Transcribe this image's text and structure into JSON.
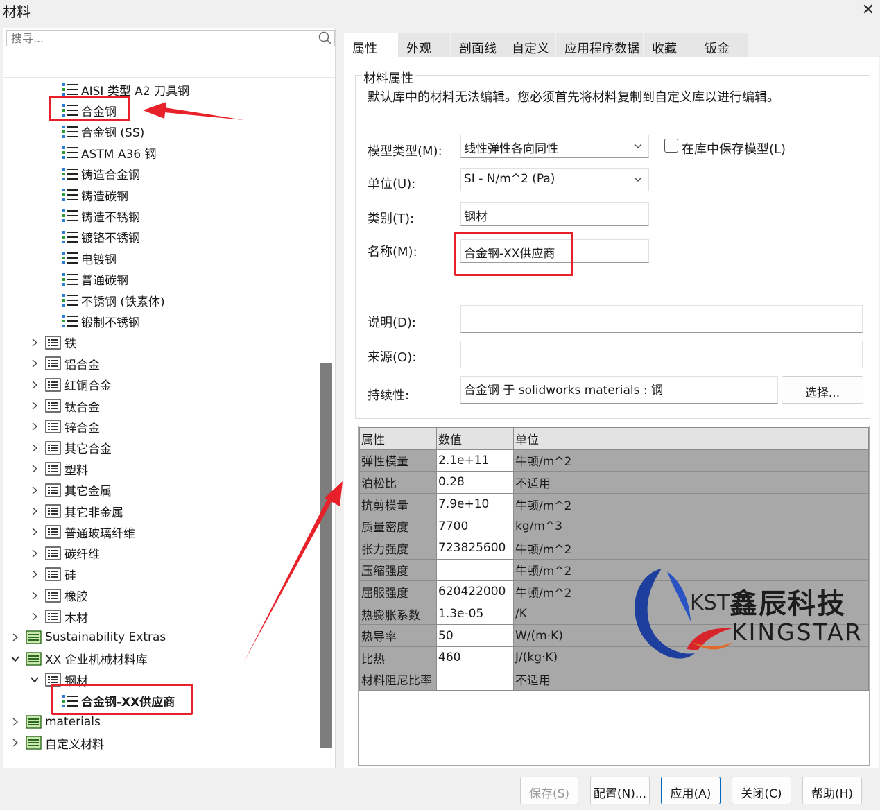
{
  "window": {
    "title": "材料"
  },
  "search": {
    "placeholder": "搜寻..."
  },
  "tree": [
    {
      "label": "AISI 类型 A2 刀具钢",
      "indent": 3,
      "icon": "material-icon",
      "chev": ""
    },
    {
      "label": "合金钢",
      "indent": 3,
      "icon": "material-icon",
      "chev": ""
    },
    {
      "label": "合金钢 (SS)",
      "indent": 3,
      "icon": "material-icon",
      "chev": ""
    },
    {
      "label": "ASTM A36 钢",
      "indent": 3,
      "icon": "material-icon",
      "chev": ""
    },
    {
      "label": "铸造合金钢",
      "indent": 3,
      "icon": "material-icon",
      "chev": ""
    },
    {
      "label": "铸造碳钢",
      "indent": 3,
      "icon": "material-icon",
      "chev": ""
    },
    {
      "label": "铸造不锈钢",
      "indent": 3,
      "icon": "material-icon",
      "chev": ""
    },
    {
      "label": "镀铬不锈钢",
      "indent": 3,
      "icon": "material-icon",
      "chev": ""
    },
    {
      "label": "电镀钢",
      "indent": 3,
      "icon": "material-icon",
      "chev": ""
    },
    {
      "label": "普通碳钢",
      "indent": 3,
      "icon": "material-icon",
      "chev": ""
    },
    {
      "label": "不锈钢 (铁素体)",
      "indent": 3,
      "icon": "material-icon",
      "chev": ""
    },
    {
      "label": "锻制不锈钢",
      "indent": 3,
      "icon": "material-icon",
      "chev": ""
    },
    {
      "label": "铁",
      "indent": 2,
      "icon": "category-icon",
      "chev": "right"
    },
    {
      "label": "铝合金",
      "indent": 2,
      "icon": "category-icon",
      "chev": "right"
    },
    {
      "label": "红铜合金",
      "indent": 2,
      "icon": "category-icon",
      "chev": "right"
    },
    {
      "label": "钛合金",
      "indent": 2,
      "icon": "category-icon",
      "chev": "right"
    },
    {
      "label": "锌合金",
      "indent": 2,
      "icon": "category-icon",
      "chev": "right"
    },
    {
      "label": "其它合金",
      "indent": 2,
      "icon": "category-icon",
      "chev": "right"
    },
    {
      "label": "塑料",
      "indent": 2,
      "icon": "category-icon",
      "chev": "right"
    },
    {
      "label": "其它金属",
      "indent": 2,
      "icon": "category-icon",
      "chev": "right"
    },
    {
      "label": "其它非金属",
      "indent": 2,
      "icon": "category-icon",
      "chev": "right"
    },
    {
      "label": "普通玻璃纤维",
      "indent": 2,
      "icon": "category-icon",
      "chev": "right"
    },
    {
      "label": "碳纤维",
      "indent": 2,
      "icon": "category-icon",
      "chev": "right"
    },
    {
      "label": "硅",
      "indent": 2,
      "icon": "category-icon",
      "chev": "right"
    },
    {
      "label": "橡胶",
      "indent": 2,
      "icon": "category-icon",
      "chev": "right"
    },
    {
      "label": "木材",
      "indent": 2,
      "icon": "category-icon",
      "chev": "right"
    },
    {
      "label": "Sustainability Extras",
      "indent": 1,
      "icon": "library-icon",
      "chev": "right"
    },
    {
      "label": "XX 企业机械材料库",
      "indent": 1,
      "icon": "library-icon",
      "chev": "down"
    },
    {
      "label": "钢材",
      "indent": 2,
      "icon": "category-icon",
      "chev": "down"
    },
    {
      "label": "合金钢-XX供应商",
      "indent": 3,
      "icon": "material-icon",
      "chev": "",
      "bold": true
    },
    {
      "label": "materials",
      "indent": 1,
      "icon": "library-icon",
      "chev": "right"
    },
    {
      "label": "自定义材料",
      "indent": 1,
      "icon": "library-icon",
      "chev": "right"
    }
  ],
  "tabs": [
    "属性",
    "外观",
    "剖面线",
    "自定义",
    "应用程序数据",
    "收藏",
    "钣金"
  ],
  "material_props": {
    "group_title": "材料属性",
    "notice": "默认库中的材料无法编辑。您必须首先将材料复制到自定义库以进行编辑。",
    "model_type_label": "模型类型(M):",
    "model_type_value": "线性弹性各向同性",
    "save_model_label": "在库中保存模型(L)",
    "unit_label": "单位(U):",
    "unit_value": "SI - N/m^2 (Pa)",
    "category_label": "类别(T):",
    "category_value": "钢材",
    "name_label": "名称(M):",
    "name_value": "合金钢-XX供应商",
    "description_label": "说明(D):",
    "description_value": "",
    "source_label": "来源(O):",
    "source_value": "",
    "sustainability_label": "持续性:",
    "sustainability_value": "合金钢 于 solidworks materials : 钢",
    "select_button": "选择..."
  },
  "table": {
    "headers": [
      "属性",
      "数值",
      "单位"
    ],
    "rows": [
      [
        "弹性模量",
        "2.1e+11",
        "牛顿/m^2"
      ],
      [
        "泊松比",
        "0.28",
        "不适用"
      ],
      [
        "抗剪模量",
        "7.9e+10",
        "牛顿/m^2"
      ],
      [
        "质量密度",
        "7700",
        "kg/m^3"
      ],
      [
        "张力强度",
        "723825600",
        "牛顿/m^2"
      ],
      [
        "压缩强度",
        "",
        "牛顿/m^2"
      ],
      [
        "屈服强度",
        "620422000",
        "牛顿/m^2"
      ],
      [
        "热膨胀系数",
        "1.3e-05",
        "/K"
      ],
      [
        "热导率",
        "50",
        "W/(m·K)"
      ],
      [
        "比热",
        "460",
        "J/(kg·K)"
      ],
      [
        "材料阻尼比率",
        "",
        "不适用"
      ]
    ]
  },
  "buttons": {
    "save": "保存(S)",
    "config": "配置(N)...",
    "apply": "应用(A)",
    "close": "关闭(C)",
    "help": "帮助(H)"
  },
  "logo": {
    "kst": "KST",
    "cn": "鑫辰科技",
    "en": "KINGSTAR"
  },
  "colors": {
    "annotation_red": "#e8202a",
    "table_gray": "#a8a8a8",
    "logo_blue": "#1f3f9e"
  }
}
